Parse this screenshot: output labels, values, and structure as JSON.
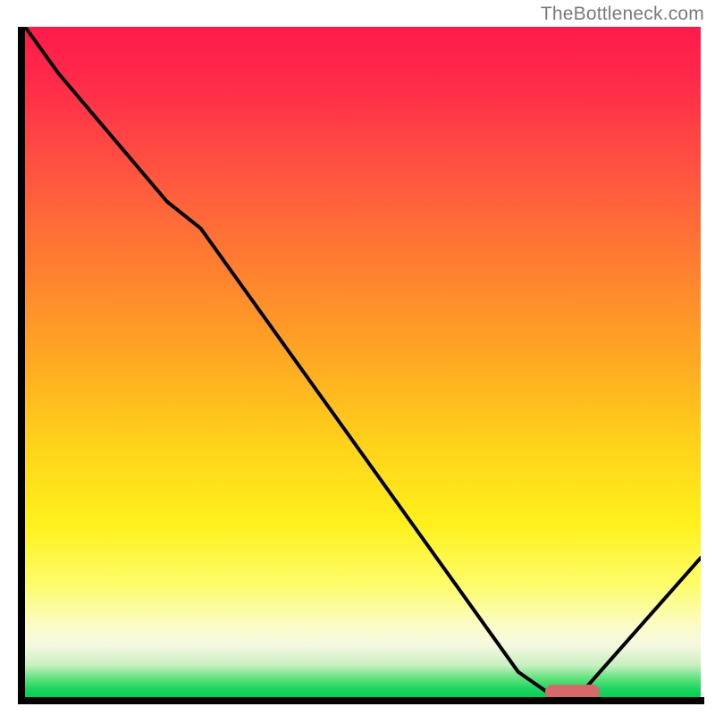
{
  "watermark": "TheBottleneck.com",
  "chart_data": {
    "type": "line",
    "title": "",
    "xlabel": "",
    "ylabel": "",
    "xlim": [
      0,
      100
    ],
    "ylim": [
      0,
      100
    ],
    "x": [
      0,
      5,
      21,
      26,
      73,
      78,
      82,
      100
    ],
    "values": [
      100,
      93,
      74,
      70,
      4,
      0.5,
      0.5,
      21
    ],
    "gradient_stops": [
      {
        "pos": 0,
        "color": "#ff1a4a"
      },
      {
        "pos": 50,
        "color": "#ffaa22"
      },
      {
        "pos": 74,
        "color": "#fff01c"
      },
      {
        "pos": 100,
        "color": "#00cc55"
      }
    ],
    "marker": {
      "x_start": 77,
      "x_end": 85,
      "color": "#d66a6a"
    }
  }
}
